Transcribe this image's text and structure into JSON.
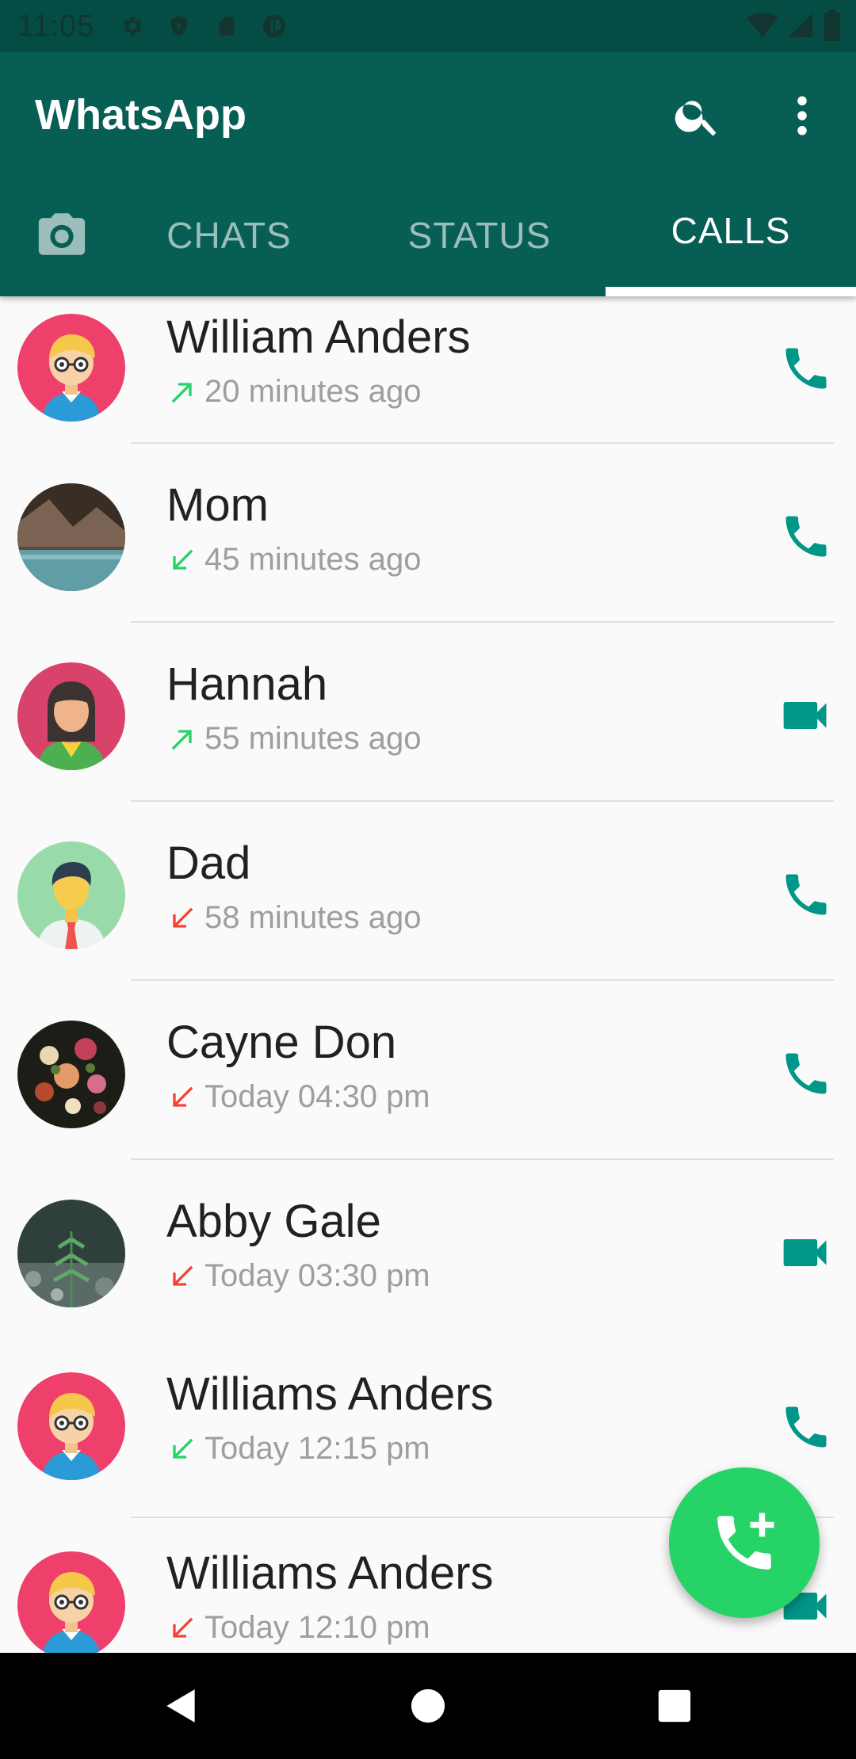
{
  "status_bar": {
    "time": "11:05",
    "left_icons": [
      "settings-icon",
      "shield-icon",
      "sd-card-icon",
      "app-icon"
    ],
    "right_icons": [
      "wifi-icon",
      "signal-icon",
      "battery-icon"
    ]
  },
  "app_bar": {
    "title": "WhatsApp",
    "actions": [
      "search-icon",
      "more-vert-icon"
    ]
  },
  "tabs": {
    "camera_icon": "camera-icon",
    "items": [
      {
        "label": "CHATS"
      },
      {
        "label": "STATUS"
      },
      {
        "label": "CALLS"
      }
    ],
    "active": "CALLS"
  },
  "calls": [
    {
      "name": "William Anders",
      "time": "20 minutes ago",
      "direction": "outgoing",
      "type": "voice",
      "avatar": "cartoon-boy-glasses"
    },
    {
      "name": "Mom",
      "time": "45 minutes ago",
      "direction": "incoming",
      "type": "voice",
      "avatar": "lake-photo"
    },
    {
      "name": "Hannah",
      "time": "55 minutes ago",
      "direction": "outgoing",
      "type": "video",
      "avatar": "cartoon-woman"
    },
    {
      "name": "Dad",
      "time": "58 minutes ago",
      "direction": "missed",
      "type": "voice",
      "avatar": "cartoon-man-tie"
    },
    {
      "name": "Cayne Don",
      "time": "Today 04:30 pm",
      "direction": "missed",
      "type": "voice",
      "avatar": "flowers-painting"
    },
    {
      "name": "Abby Gale",
      "time": "Today 03:30 pm",
      "direction": "missed",
      "type": "video",
      "avatar": "plant-photo"
    },
    {
      "name": "Williams Anders",
      "time": "Today 12:15 pm",
      "direction": "incoming",
      "type": "voice",
      "avatar": "cartoon-boy-glasses"
    },
    {
      "name": "Williams Anders",
      "time": "Today 12:10 pm",
      "direction": "missed",
      "type": "video",
      "avatar": "cartoon-boy-glasses"
    }
  ],
  "fab": {
    "icon": "add-call-icon"
  },
  "nav_bar": {
    "buttons": [
      "back-icon",
      "home-icon",
      "recents-icon"
    ]
  },
  "colors": {
    "primary": "#075e54",
    "status_bar": "#054d44",
    "accent": "#25d366",
    "call_icon": "#009688",
    "outgoing_arrow": "#25d366",
    "missed_arrow": "#f44336"
  }
}
